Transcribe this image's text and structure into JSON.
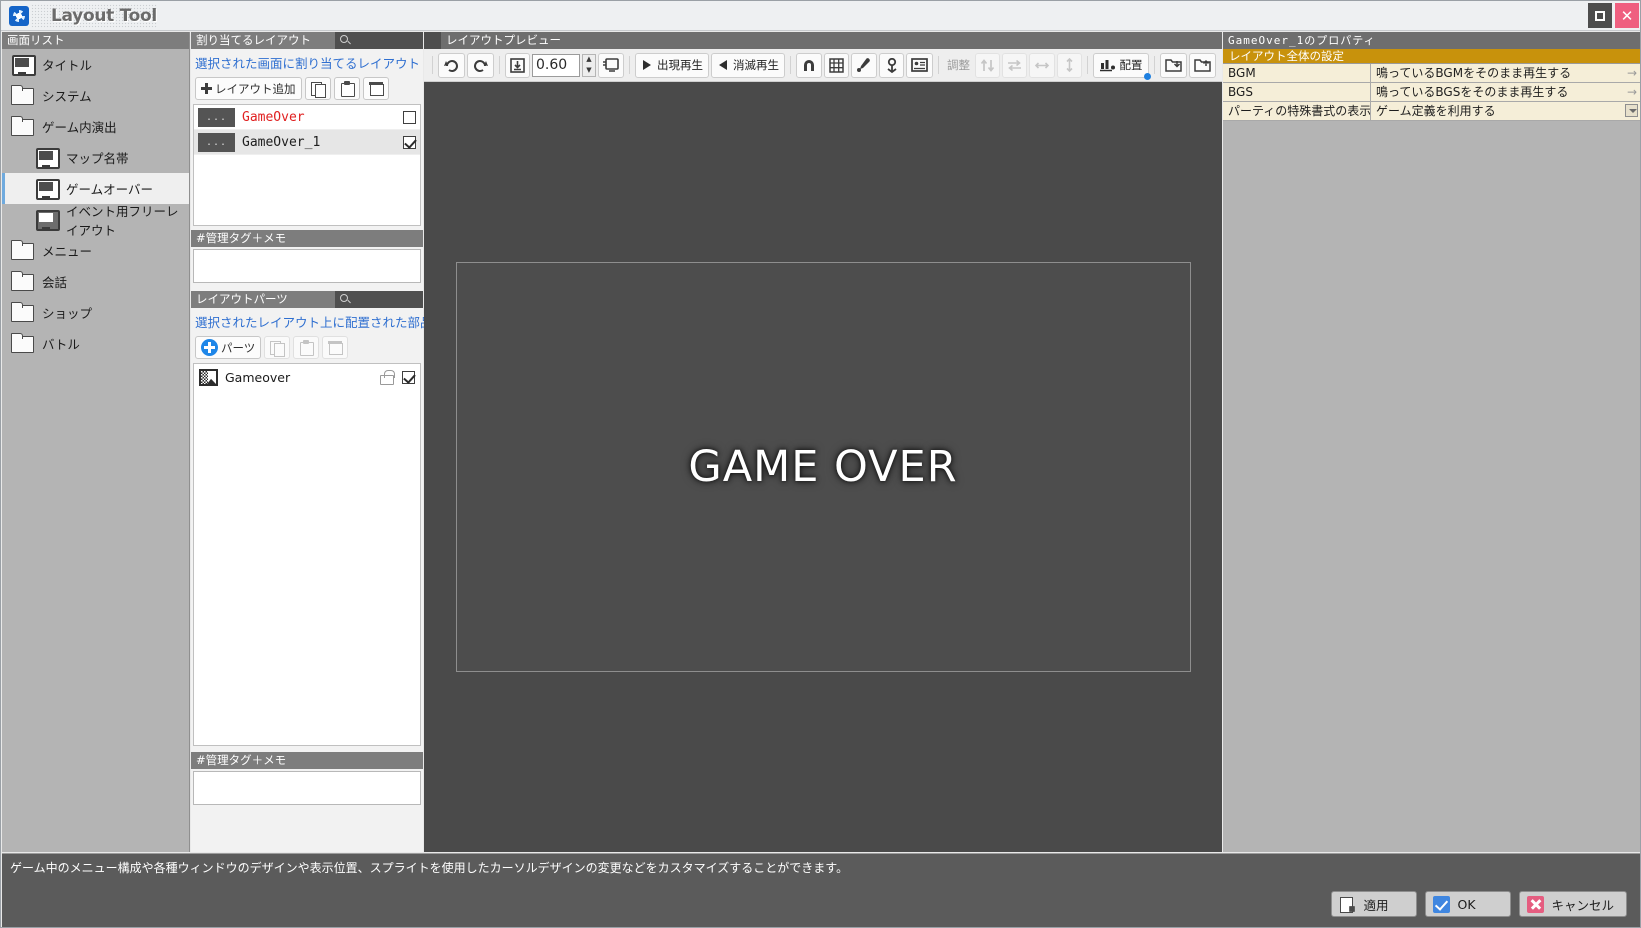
{
  "window": {
    "title": "Layout Tool",
    "maximize_label": "□",
    "close_label": "✕"
  },
  "screen_list": {
    "header": "画面リスト",
    "items": [
      {
        "label": "タイトル",
        "icon": "screen-icon",
        "indent": false,
        "selected": false
      },
      {
        "label": "システム",
        "icon": "folder-icon",
        "indent": false,
        "selected": false
      },
      {
        "label": "ゲーム内演出",
        "icon": "folder-icon",
        "indent": false,
        "selected": false
      },
      {
        "label": "マップ名帯",
        "icon": "screen-icon",
        "indent": true,
        "selected": false
      },
      {
        "label": "ゲームオーバー",
        "icon": "screen-icon",
        "indent": true,
        "selected": true
      },
      {
        "label": "イベント用フリーレイアウト",
        "icon": "screen-filled-icon",
        "indent": true,
        "selected": false
      },
      {
        "label": "メニュー",
        "icon": "folder-icon",
        "indent": false,
        "selected": false
      },
      {
        "label": "会話",
        "icon": "folder-icon",
        "indent": false,
        "selected": false
      },
      {
        "label": "ショップ",
        "icon": "folder-icon",
        "indent": false,
        "selected": false
      },
      {
        "label": "バトル",
        "icon": "folder-icon",
        "indent": false,
        "selected": false
      }
    ]
  },
  "assigned_layout": {
    "header": "割り当てるレイアウト",
    "search_placeholder": "",
    "hint": "選択された画面に割り当てるレイアウト",
    "buttons": {
      "add": "レイアウト追加",
      "copy": "",
      "paste": "",
      "delete": ""
    },
    "rows": [
      {
        "thumb": "...",
        "name": "GameOver",
        "checked": false,
        "name_color": "red"
      },
      {
        "thumb": "...",
        "name": "GameOver_1",
        "checked": true,
        "name_color": "normal"
      }
    ],
    "memo_header": "#管理タグ＋メモ",
    "memo_value": ""
  },
  "layout_parts": {
    "header": "レイアウトパーツ",
    "search_placeholder": "",
    "hint": "選択されたレイアウト上に配置された部品",
    "buttons": {
      "add": "パーツ",
      "copy": "",
      "paste": "",
      "delete": ""
    },
    "rows": [
      {
        "name": "Gameover",
        "locked": false,
        "checked": true
      }
    ],
    "memo_header": "#管理タグ＋メモ",
    "memo_value": ""
  },
  "preview": {
    "header": "レイアウトプレビュー",
    "toolbar": {
      "redo_icon": "redo-icon",
      "undo_icon": "undo-icon",
      "fit_icon": "fit-to-screen-icon",
      "zoom_value": "0.60",
      "spin_up": "▲",
      "spin_down": "▼",
      "monitor_icon": "monitor-icon",
      "play_in_label": "出現再生",
      "play_out_label": "消滅再生",
      "magnet_icon": "magnet-icon",
      "grid_icon": "grid-icon",
      "eyedropper_icon": "eyedropper-icon",
      "anchor_icon": "anchor-icon",
      "preview-box_icon": "id-card-icon",
      "adjust_label": "調整",
      "align_v_icon": "align-vertical-icon",
      "swap_icon": "swap-icon",
      "fit_h_icon": "fit-horizontal-icon",
      "fit_v_icon": "fit-vertical-icon",
      "arrange_label": "配置",
      "import_icon": "import-folder-icon",
      "export_icon": "export-folder-icon"
    },
    "canvas_text": "GAME OVER"
  },
  "properties": {
    "header": "GameOver_1のプロパティ",
    "group_label": "レイアウト全体の設定",
    "rows": [
      {
        "key": "BGM",
        "value": "鳴っているBGMをそのまま再生する",
        "control": "arrow"
      },
      {
        "key": "BGS",
        "value": "鳴っているBGSをそのまま再生する",
        "control": "arrow"
      },
      {
        "key": "パーティの特殊書式の表示",
        "value": "ゲーム定義を利用する",
        "control": "dropdown"
      }
    ]
  },
  "status": {
    "message": "ゲーム中のメニュー構成や各種ウィンドウのデザインや表示位置、スプライトを使用したカーソルデザインの変更などをカスタマイズすることができます。"
  },
  "footer": {
    "apply": "適用",
    "ok": "OK",
    "cancel": "キャンセル"
  },
  "colors": {
    "accent_blue": "#1e86e8",
    "group_gold": "#c8920c",
    "prop_bg": "#f5eed8",
    "panel_gray": "#b4b4b4",
    "header_gray": "#7d7d7d",
    "preview_bg": "#4a4a4a",
    "red_text": "#e02020",
    "hint_blue": "#2f6fd0",
    "close_pink": "#ef5f80"
  }
}
